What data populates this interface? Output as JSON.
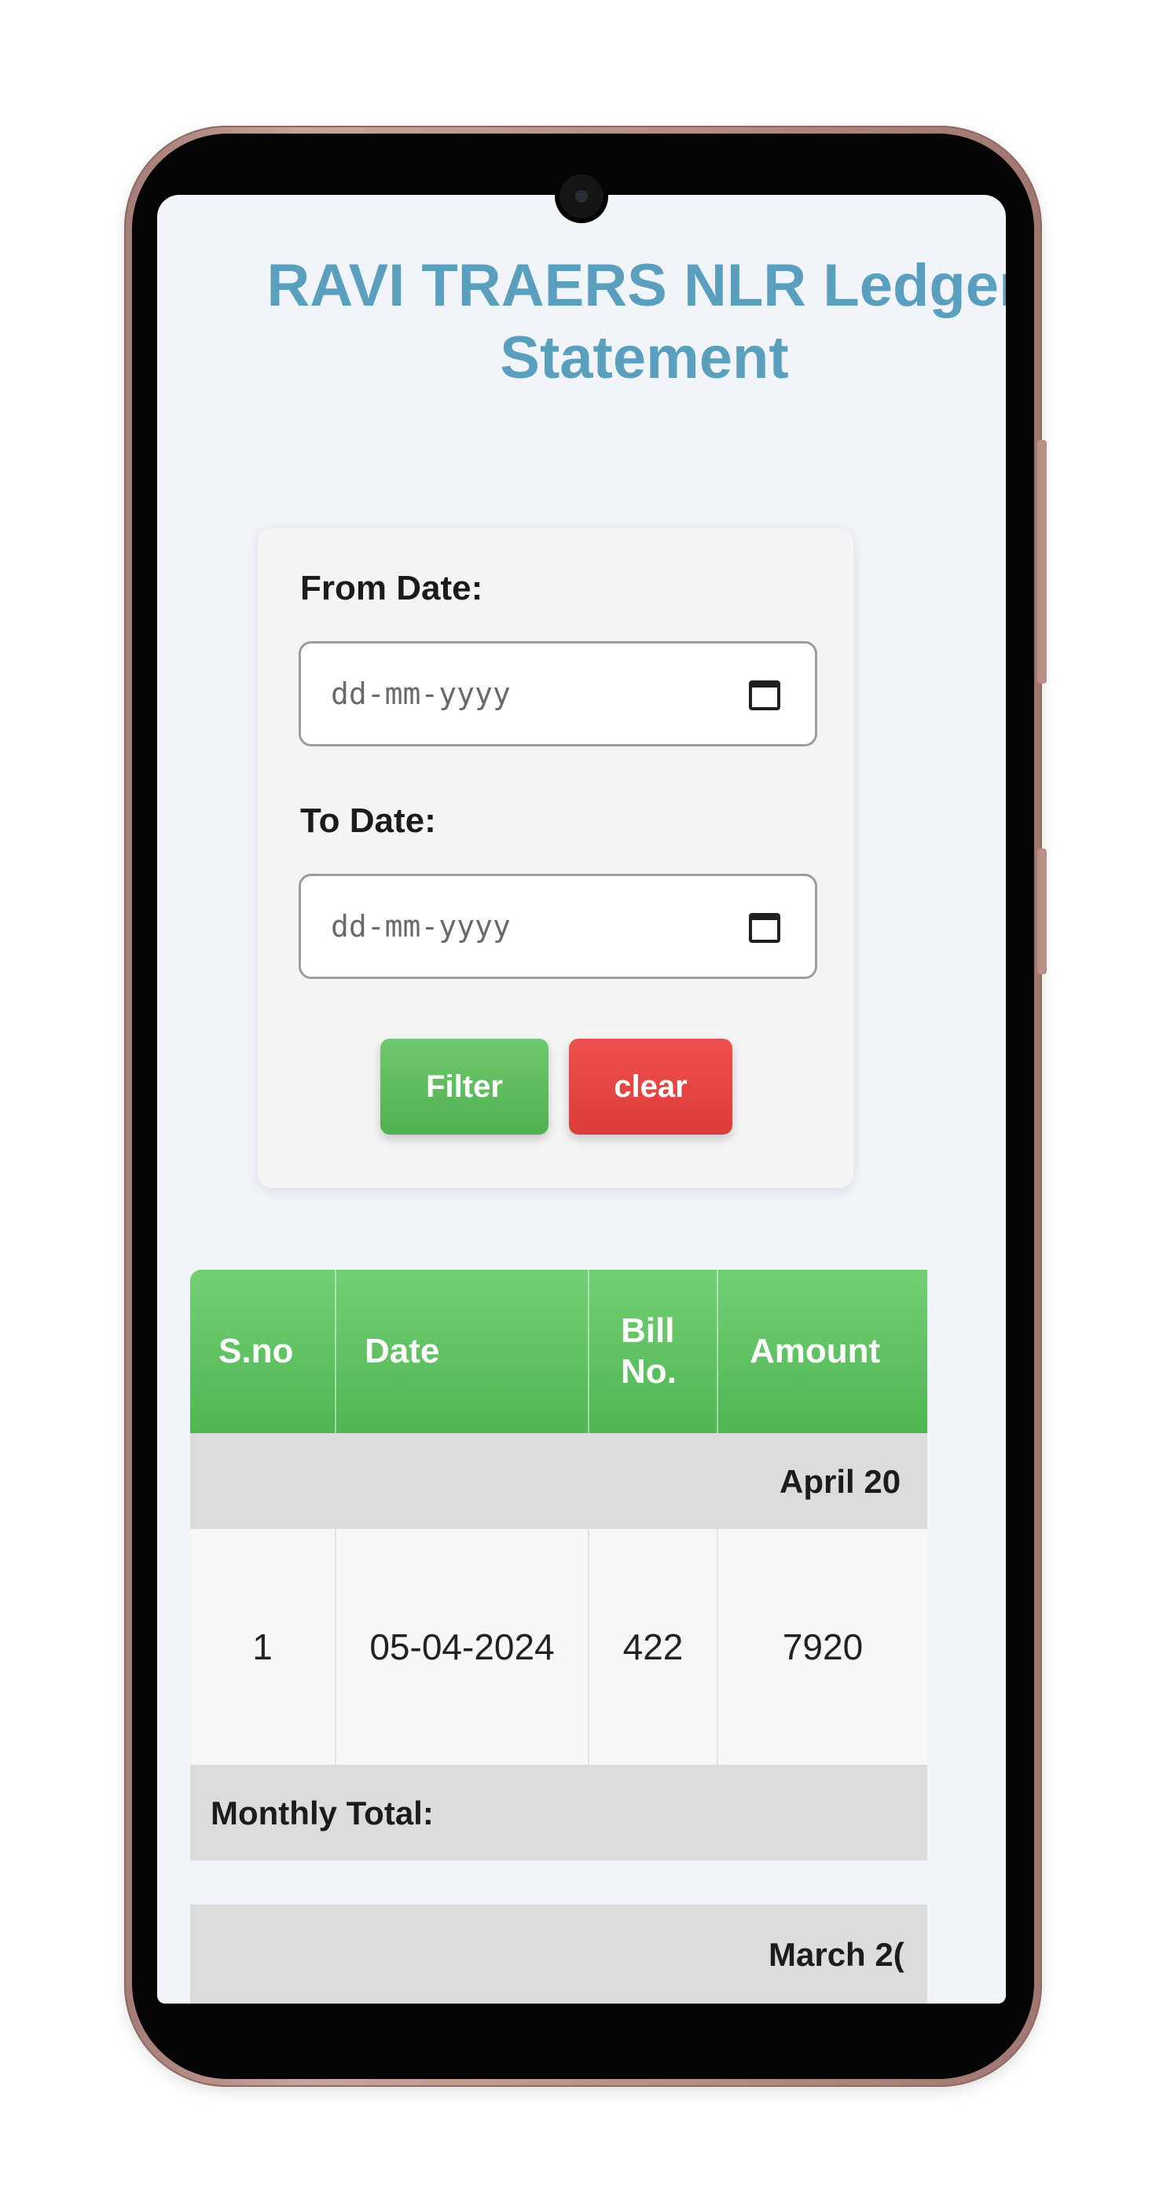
{
  "page": {
    "title": "RAVI TRAERS NLR Ledger Statement"
  },
  "filter": {
    "from_label": "From Date:",
    "from_placeholder": "dd-mm-yyyy",
    "to_label": "To Date:",
    "to_placeholder": "dd-mm-yyyy",
    "filter_button": "Filter",
    "clear_button": "clear"
  },
  "table": {
    "headers": {
      "sno": "S.no",
      "date": "Date",
      "bill_no": "Bill No.",
      "amount": "Amount"
    },
    "groups": [
      {
        "month": "April 20",
        "rows": [
          {
            "sno": "1",
            "date": "05-04-2024",
            "bill_no": "422",
            "amount": "7920"
          }
        ],
        "total_label": "Monthly Total:"
      },
      {
        "month": "March 2(",
        "rows": []
      }
    ]
  },
  "colors": {
    "title": "#5b9fbf",
    "header_green": "#5cbf5e",
    "filter_green": "#5cb85c",
    "clear_red": "#e2403e",
    "group_gray": "#dcdcdc",
    "screen_bg": "#f1f4f8",
    "phone_frame": "#b88e86"
  }
}
